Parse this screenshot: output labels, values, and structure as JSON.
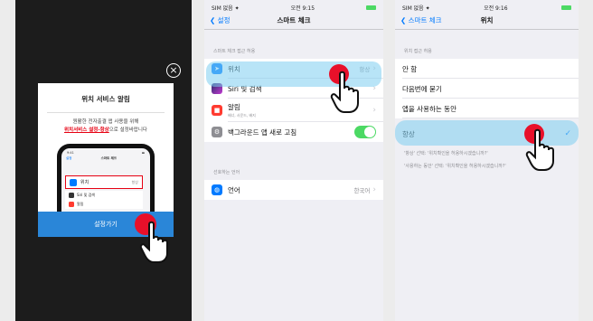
{
  "panel1": {
    "close_symbol": "×",
    "modal_title": "위치 서비스 알림",
    "message_line1": "원활한 전자출결 앱 사용을 위해",
    "message_highlight": "위치서비스 설정-항상",
    "message_rest": "으로 설정바랍니다",
    "phone": {
      "time": "9:41",
      "back": "설정",
      "title": "스마트 체크",
      "row_location": "위치",
      "row_location_value": "항상",
      "row_siri": "Siri 및 검색",
      "row_notifications": "알림"
    },
    "button": "설정가기"
  },
  "panel2": {
    "status_left": "SIM 없음 ✦",
    "status_time": "오전 9:15",
    "back_label": "설정",
    "title": "스마트 체크",
    "section1_header": "스마트 체크 접근 허용",
    "rows": {
      "location": "위치",
      "location_value": "항상",
      "siri": "Siri 및 검색",
      "notifications": "알림",
      "notifications_sub": "배너, 사운드, 배지",
      "background": "백그라운드 앱 새로 고침"
    },
    "section2_header": "선호하는 언어",
    "language": "언어",
    "language_value": "한국어"
  },
  "panel3": {
    "status_left": "SIM 없음 ✦",
    "status_time": "오전 9:16",
    "back_label": "스마트 체크",
    "title": "위치",
    "section_header": "위치 접근 허용",
    "options": [
      "안 함",
      "다음번에 묻기",
      "앱을 사용하는 동안",
      "항상"
    ],
    "checkmark": "✓",
    "footer1": "'항상' 선택: '위치확인을 허용하시겠습니까?'",
    "footer2": "'사용하는 동안' 선택: '위치확인을 허용하시겠습니까?'"
  },
  "colors": {
    "ios_blue": "#007aff",
    "button_blue": "#2a86d8",
    "tap_red": "#e8102a",
    "toggle_green": "#4cd964",
    "highlight": "#7dcef0"
  }
}
